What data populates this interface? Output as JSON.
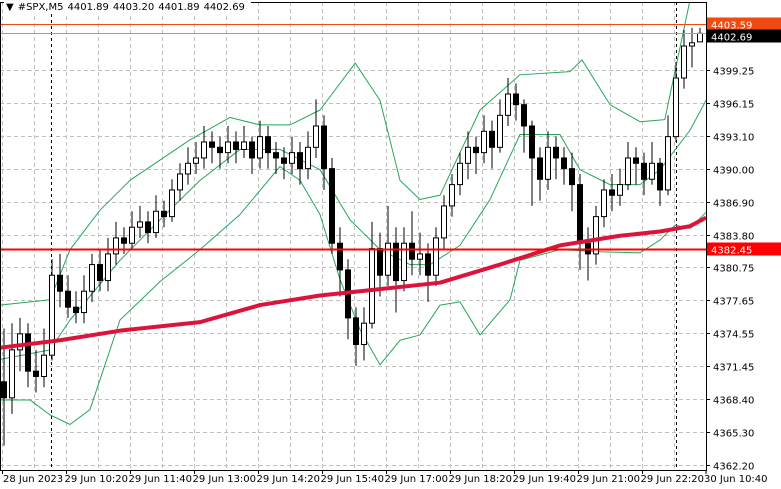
{
  "header": {
    "symbol": "#SPX,M5",
    "open": "4401.89",
    "high": "4403.20",
    "low": "4401.89",
    "close": "4402.69"
  },
  "colors": {
    "bull_body": "#ffffff",
    "bear_body": "#000000",
    "bands": "#26a65b",
    "ma": "#dc143c",
    "level": "#ff0000",
    "ask": "#f04a10",
    "bid_label_bg": "#000000",
    "grid": "#c0c0c0"
  },
  "chart_data": {
    "type": "candlestick",
    "title": "#SPX,M5",
    "ylim": [
      4361.73,
      4405.63
    ],
    "y_ticks": [
      "4399.25",
      "4396.15",
      "4393.10",
      "4390.00",
      "4386.90",
      "4383.80",
      "4380.75",
      "4377.65",
      "4374.55",
      "4371.45",
      "4368.40",
      "4365.30",
      "4362.20"
    ],
    "x_ticks": [
      {
        "bar": 0,
        "label": "28 Jun 2023"
      },
      {
        "bar": 8,
        "label": "29 Jun 10:20"
      },
      {
        "bar": 16,
        "label": "29 Jun 11:40"
      },
      {
        "bar": 24,
        "label": "29 Jun 13:00"
      },
      {
        "bar": 32,
        "label": "29 Jun 14:20"
      },
      {
        "bar": 40,
        "label": "29 Jun 15:40"
      },
      {
        "bar": 48,
        "label": "29 Jun 17:00"
      },
      {
        "bar": 56,
        "label": "29 Jun 18:20"
      },
      {
        "bar": 64,
        "label": "29 Jun 19:40"
      },
      {
        "bar": 72,
        "label": "29 Jun 21:00"
      },
      {
        "bar": 80,
        "label": "29 Jun 22:20"
      },
      {
        "bar": 88,
        "label": "30 Jun 10:40"
      }
    ],
    "day_separators": [
      5.9,
      84
    ],
    "candles_ohlc": [
      [
        4370,
        4375,
        4364,
        4368.5
      ],
      [
        4368.5,
        4375.5,
        4367,
        4373
      ],
      [
        4373,
        4376,
        4371,
        4374.5
      ],
      [
        4374.5,
        4375.5,
        4369.5,
        4371
      ],
      [
        4371,
        4373,
        4369,
        4370.5
      ],
      [
        4370.5,
        4375,
        4369.5,
        4372.5
      ],
      [
        4372.5,
        4381.5,
        4372,
        4380
      ],
      [
        4380,
        4382,
        4377,
        4378.5
      ],
      [
        4378.5,
        4380,
        4376,
        4377
      ],
      [
        4377,
        4378.5,
        4375.5,
        4376.5
      ],
      [
        4376.5,
        4380,
        4375.5,
        4378.5
      ],
      [
        4378.5,
        4382,
        4377.5,
        4381
      ],
      [
        4381,
        4382.5,
        4378.5,
        4379.5
      ],
      [
        4379.5,
        4383.5,
        4378.5,
        4382
      ],
      [
        4382,
        4385,
        4381,
        4383.5
      ],
      [
        4383.5,
        4384.5,
        4382,
        4383
      ],
      [
        4383,
        4386,
        4382.5,
        4384.5
      ],
      [
        4384.5,
        4386.5,
        4383.5,
        4385
      ],
      [
        4385,
        4386,
        4383,
        4384
      ],
      [
        4384,
        4387.5,
        4383.5,
        4386
      ],
      [
        4386,
        4387,
        4384.5,
        4385.5
      ],
      [
        4385.5,
        4389,
        4385,
        4388
      ],
      [
        4388,
        4390.5,
        4387,
        4389.5
      ],
      [
        4389.5,
        4392,
        4388.5,
        4390.5
      ],
      [
        4390.5,
        4392.5,
        4389.5,
        4391
      ],
      [
        4391,
        4394,
        4390,
        4392.5
      ],
      [
        4392.5,
        4393.5,
        4390.5,
        4392
      ],
      [
        4392,
        4393,
        4390,
        4391.5
      ],
      [
        4391.5,
        4394,
        4390.5,
        4392.5
      ],
      [
        4392.5,
        4393.5,
        4390.5,
        4391.8
      ],
      [
        4391.8,
        4394,
        4391,
        4392.5
      ],
      [
        4392.5,
        4393,
        4389.5,
        4391
      ],
      [
        4391,
        4394.5,
        4390,
        4393
      ],
      [
        4393,
        4394,
        4390,
        4391.5
      ],
      [
        4391.5,
        4392.5,
        4389.5,
        4391
      ],
      [
        4391,
        4392,
        4389,
        4390.5
      ],
      [
        4390.5,
        4393,
        4389.5,
        4391.5
      ],
      [
        4391.5,
        4392.5,
        4388.5,
        4390
      ],
      [
        4390,
        4393.5,
        4389,
        4392
      ],
      [
        4392,
        4396.5,
        4391,
        4394
      ],
      [
        4394,
        4395,
        4388,
        4390
      ],
      [
        4390,
        4391,
        4382,
        4383
      ],
      [
        4383,
        4384.5,
        4378,
        4380.5
      ],
      [
        4380.5,
        4381.5,
        4374,
        4376
      ],
      [
        4376,
        4377,
        4371.5,
        4373.5
      ],
      [
        4373.5,
        4377,
        4372,
        4375.5
      ],
      [
        4375.5,
        4385,
        4375,
        4382.5
      ],
      [
        4382.5,
        4384,
        4378,
        4380
      ],
      [
        4380,
        4386.5,
        4379,
        4383
      ],
      [
        4383,
        4384.5,
        4376.5,
        4379.5
      ],
      [
        4379.5,
        4384.5,
        4378.5,
        4383
      ],
      [
        4383,
        4386,
        4380,
        4381.5
      ],
      [
        4381.5,
        4384,
        4380,
        4382
      ],
      [
        4382,
        4383,
        4377.5,
        4380
      ],
      [
        4380,
        4384.5,
        4379,
        4383.5
      ],
      [
        4383.5,
        4387.5,
        4382.5,
        4386.5
      ],
      [
        4386.5,
        4389.5,
        4385.5,
        4388.5
      ],
      [
        4388.5,
        4391.5,
        4387.5,
        4390.5
      ],
      [
        4390.5,
        4393.5,
        4389,
        4392
      ],
      [
        4392,
        4393,
        4389.5,
        4391.5
      ],
      [
        4391.5,
        4395,
        4390.5,
        4393.5
      ],
      [
        4393.5,
        4394.5,
        4390,
        4392
      ],
      [
        4392,
        4396.5,
        4391.5,
        4395
      ],
      [
        4395,
        4398.5,
        4394,
        4397
      ],
      [
        4397,
        4398,
        4394.5,
        4396
      ],
      [
        4396,
        4396.5,
        4391.5,
        4394
      ],
      [
        4394,
        4394.5,
        4386.5,
        4391
      ],
      [
        4391,
        4392,
        4387,
        4389
      ],
      [
        4389,
        4393.5,
        4388,
        4392
      ],
      [
        4392,
        4393,
        4389,
        4391
      ],
      [
        4391,
        4392,
        4388.5,
        4390
      ],
      [
        4390,
        4391.5,
        4386,
        4388.5
      ],
      [
        4388.5,
        4389.5,
        4380.5,
        4383
      ],
      [
        4383,
        4384.5,
        4379.5,
        4382
      ],
      [
        4382,
        4386.5,
        4381,
        4385.5
      ],
      [
        4385.5,
        4389,
        4384.5,
        4388
      ],
      [
        4388,
        4389.5,
        4386,
        4387.5
      ],
      [
        4387.5,
        4390,
        4386.5,
        4388.5
      ],
      [
        4388.5,
        4392.5,
        4388,
        4391
      ],
      [
        4391,
        4392,
        4388.5,
        4390.5
      ],
      [
        4390.5,
        4391.5,
        4387.5,
        4389
      ],
      [
        4389,
        4392.5,
        4388.5,
        4390.5
      ],
      [
        4390.5,
        4391,
        4386.5,
        4388
      ],
      [
        4388,
        4395,
        4387.5,
        4393
      ],
      [
        4393,
        4400,
        4392.5,
        4398.5
      ],
      [
        4398.5,
        4403,
        4397.5,
        4401.5
      ],
      [
        4401.5,
        4403.2,
        4399.5,
        4401.8
      ],
      [
        4401.89,
        4403.2,
        4401.89,
        4402.69
      ]
    ],
    "bollinger_upper": [
      [
        -0.5,
        4377.2
      ],
      [
        5.75,
        4377.7
      ],
      [
        8.25,
        4382.4
      ],
      [
        12,
        4386.1
      ],
      [
        15.75,
        4388.9
      ],
      [
        23.25,
        4392.7
      ],
      [
        28.25,
        4394.8
      ],
      [
        32,
        4394.1
      ],
      [
        35.75,
        4394.1
      ],
      [
        39.5,
        4395.5
      ],
      [
        43.9,
        4399.9
      ],
      [
        47,
        4396.4
      ],
      [
        49.5,
        4388.9
      ],
      [
        52,
        4387.1
      ],
      [
        54.5,
        4387.5
      ],
      [
        59.5,
        4395.5
      ],
      [
        64.5,
        4398.8
      ],
      [
        70.75,
        4399.1
      ],
      [
        72.25,
        4400.2
      ],
      [
        75.75,
        4396.0
      ],
      [
        79.5,
        4394.4
      ],
      [
        82.6,
        4394.6
      ],
      [
        85.75,
        4405.8
      ]
    ],
    "bollinger_middle": [
      [
        -0.5,
        4372.1
      ],
      [
        5.75,
        4373.0
      ],
      [
        8.25,
        4375.8
      ],
      [
        14.5,
        4381.4
      ],
      [
        19.5,
        4385.2
      ],
      [
        24.5,
        4388.9
      ],
      [
        29.5,
        4391.8
      ],
      [
        34.5,
        4391.8
      ],
      [
        39.5,
        4389.9
      ],
      [
        43.25,
        4385.2
      ],
      [
        47,
        4382.4
      ],
      [
        50.75,
        4381.0
      ],
      [
        53.25,
        4381.0
      ],
      [
        57,
        4382.8
      ],
      [
        60.75,
        4387.1
      ],
      [
        64.5,
        4393.2
      ],
      [
        69.5,
        4393.2
      ],
      [
        72,
        4389.9
      ],
      [
        75.75,
        4388.5
      ],
      [
        79.5,
        4388.5
      ],
      [
        82,
        4389.9
      ],
      [
        85.75,
        4393.6
      ],
      [
        87.75,
        4396.4
      ]
    ],
    "bollinger_lower": [
      [
        -0.5,
        4368.3
      ],
      [
        3.25,
        4368.3
      ],
      [
        5.75,
        4366.9
      ],
      [
        8.25,
        4366.0
      ],
      [
        10.75,
        4367.4
      ],
      [
        14.5,
        4375.8
      ],
      [
        19.5,
        4379.4
      ],
      [
        24.5,
        4382.4
      ],
      [
        29.5,
        4385.7
      ],
      [
        34.5,
        4390.2
      ],
      [
        37,
        4388.9
      ],
      [
        39.5,
        4385.7
      ],
      [
        42,
        4379.6
      ],
      [
        44.5,
        4374.9
      ],
      [
        47,
        4371.6
      ],
      [
        49.5,
        4373.9
      ],
      [
        52,
        4374.4
      ],
      [
        54.5,
        4377.2
      ],
      [
        57,
        4377.5
      ],
      [
        59.5,
        4374.4
      ],
      [
        63.25,
        4377.7
      ],
      [
        64.5,
        4381.4
      ],
      [
        69.5,
        4382.4
      ],
      [
        74.5,
        4382.2
      ],
      [
        79.5,
        4382.1
      ],
      [
        82,
        4383.3
      ],
      [
        83.9,
        4384.7
      ],
      [
        85.75,
        4384.4
      ],
      [
        87.75,
        4385.9
      ]
    ],
    "moving_average": [
      [
        -0.5,
        4373.2
      ],
      [
        7,
        4373.9
      ],
      [
        14.5,
        4374.8
      ],
      [
        24.5,
        4375.6
      ],
      [
        32,
        4377.2
      ],
      [
        39.5,
        4378.1
      ],
      [
        47,
        4378.7
      ],
      [
        54.5,
        4379.3
      ],
      [
        62,
        4381.0
      ],
      [
        69.5,
        4382.8
      ],
      [
        77,
        4383.7
      ],
      [
        82,
        4384.1
      ],
      [
        85.75,
        4384.6
      ],
      [
        87.75,
        4385.4
      ]
    ],
    "level_line": {
      "value": 4382.45,
      "label": "4382.45"
    },
    "bid_line": {
      "value": 4402.69,
      "label": "4402.69"
    },
    "ask_line": {
      "value": 4403.59,
      "label": "4403.59"
    },
    "grid": true
  }
}
